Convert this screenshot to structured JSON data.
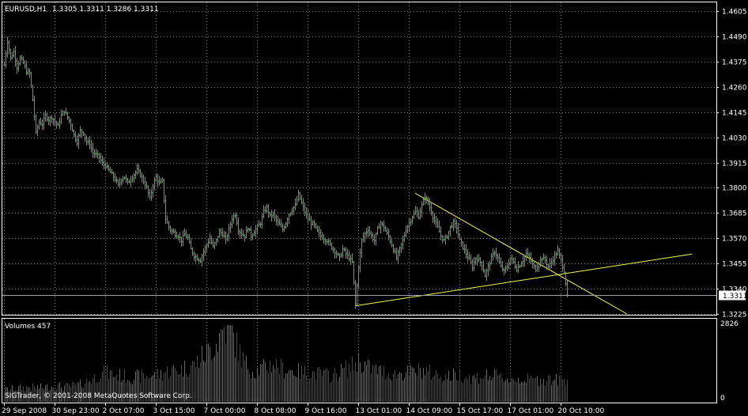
{
  "header": {
    "symbol": "EURUSD,H1",
    "ohlc": "1.3305 1.3311 1.3286 1.3311",
    "volume_title": "Volumes 457",
    "copyright": "SIGTrader, © 2001-2008 MetaQuotes Software Corp."
  },
  "colors": {
    "background": "#000000",
    "frame": "#ffffff",
    "grid": "#6d8fa3",
    "bar": "#2fbf2f",
    "volume_up": "#1f9f1f",
    "volume_down": "#b11c1c",
    "trendline": "#f5f54a",
    "price_line": "#9aa3ad",
    "current_price_box": "#ffffff"
  },
  "current_price": "1.3311",
  "chart_data": [
    {
      "type": "ohlc-bar",
      "title": "EURUSD,H1",
      "y_ticks": [
        1.4605,
        1.449,
        1.4375,
        1.426,
        1.4145,
        1.403,
        1.3915,
        1.38,
        1.3685,
        1.357,
        1.3455,
        1.334,
        1.3225
      ],
      "y_tick_labels": [
        "1.4605",
        "1.4490",
        "1.4375",
        "1.4260",
        "1.4145",
        "1.4030",
        "1.3915",
        "1.3800",
        "1.3685",
        "1.3570",
        "1.3455",
        "1.3340",
        "1.3225"
      ],
      "ylim": [
        1.3225,
        1.4605
      ],
      "x_tick_labels": [
        "29 Sep 2008",
        "30 Sep 23:00",
        "2 Oct 07:00",
        "3 Oct 15:00",
        "7 Oct 00:00",
        "8 Oct 08:00",
        "9 Oct 16:00",
        "13 Oct 01:00",
        "14 Oct 09:00",
        "15 Oct 17:00",
        "17 Oct 01:00",
        "20 Oct 10:00"
      ],
      "x_tick_index": [
        0,
        32,
        64,
        96,
        128,
        160,
        192,
        224,
        256,
        288,
        320,
        352
      ],
      "grid": true,
      "close_path": [
        [
          0,
          1.436
        ],
        [
          2,
          1.447
        ],
        [
          4,
          1.439
        ],
        [
          6,
          1.442
        ],
        [
          8,
          1.435
        ],
        [
          10,
          1.439
        ],
        [
          12,
          1.437
        ],
        [
          14,
          1.433
        ],
        [
          16,
          1.432
        ],
        [
          18,
          1.42
        ],
        [
          20,
          1.405
        ],
        [
          22,
          1.41
        ],
        [
          24,
          1.409
        ],
        [
          26,
          1.413
        ],
        [
          28,
          1.411
        ],
        [
          30,
          1.412
        ],
        [
          32,
          1.41
        ],
        [
          34,
          1.408
        ],
        [
          36,
          1.413
        ],
        [
          38,
          1.415
        ],
        [
          40,
          1.412
        ],
        [
          42,
          1.409
        ],
        [
          44,
          1.404
        ],
        [
          46,
          1.401
        ],
        [
          48,
          1.406
        ],
        [
          50,
          1.405
        ],
        [
          52,
          1.401
        ],
        [
          54,
          1.4
        ],
        [
          56,
          1.396
        ],
        [
          58,
          1.395
        ],
        [
          60,
          1.394
        ],
        [
          62,
          1.391
        ],
        [
          64,
          1.39
        ],
        [
          66,
          1.388
        ],
        [
          68,
          1.386
        ],
        [
          70,
          1.384
        ],
        [
          72,
          1.381
        ],
        [
          74,
          1.384
        ],
        [
          76,
          1.385
        ],
        [
          78,
          1.382
        ],
        [
          80,
          1.384
        ],
        [
          82,
          1.386
        ],
        [
          84,
          1.388
        ],
        [
          86,
          1.386
        ],
        [
          88,
          1.383
        ],
        [
          90,
          1.38
        ],
        [
          92,
          1.375
        ],
        [
          94,
          1.381
        ],
        [
          96,
          1.385
        ],
        [
          98,
          1.382
        ],
        [
          100,
          1.383
        ],
        [
          102,
          1.366
        ],
        [
          104,
          1.362
        ],
        [
          106,
          1.36
        ],
        [
          108,
          1.359
        ],
        [
          110,
          1.358
        ],
        [
          112,
          1.356
        ],
        [
          114,
          1.359
        ],
        [
          116,
          1.357
        ],
        [
          118,
          1.352
        ],
        [
          120,
          1.349
        ],
        [
          122,
          1.348
        ],
        [
          124,
          1.347
        ],
        [
          126,
          1.351
        ],
        [
          128,
          1.354
        ],
        [
          130,
          1.357
        ],
        [
          132,
          1.353
        ],
        [
          134,
          1.356
        ],
        [
          136,
          1.36
        ],
        [
          138,
          1.359
        ],
        [
          140,
          1.356
        ],
        [
          142,
          1.361
        ],
        [
          144,
          1.366
        ],
        [
          146,
          1.368
        ],
        [
          148,
          1.361
        ],
        [
          150,
          1.359
        ],
        [
          152,
          1.358
        ],
        [
          154,
          1.362
        ],
        [
          156,
          1.358
        ],
        [
          158,
          1.36
        ],
        [
          160,
          1.362
        ],
        [
          162,
          1.364
        ],
        [
          164,
          1.369
        ],
        [
          166,
          1.371
        ],
        [
          168,
          1.367
        ],
        [
          170,
          1.368
        ],
        [
          172,
          1.365
        ],
        [
          174,
          1.363
        ],
        [
          176,
          1.361
        ],
        [
          178,
          1.364
        ],
        [
          180,
          1.368
        ],
        [
          182,
          1.37
        ],
        [
          184,
          1.372
        ],
        [
          186,
          1.377
        ],
        [
          188,
          1.373
        ],
        [
          190,
          1.369
        ],
        [
          192,
          1.366
        ],
        [
          194,
          1.364
        ],
        [
          196,
          1.363
        ],
        [
          198,
          1.36
        ],
        [
          200,
          1.358
        ],
        [
          202,
          1.357
        ],
        [
          204,
          1.356
        ],
        [
          206,
          1.354
        ],
        [
          208,
          1.352
        ],
        [
          210,
          1.35
        ],
        [
          212,
          1.348
        ],
        [
          214,
          1.352
        ],
        [
          216,
          1.35
        ],
        [
          218,
          1.348
        ],
        [
          220,
          1.346
        ],
        [
          222,
          1.327
        ],
        [
          224,
          1.344
        ],
        [
          226,
          1.356
        ],
        [
          228,
          1.359
        ],
        [
          230,
          1.361
        ],
        [
          232,
          1.358
        ],
        [
          234,
          1.356
        ],
        [
          236,
          1.361
        ],
        [
          238,
          1.364
        ],
        [
          240,
          1.362
        ],
        [
          242,
          1.359
        ],
        [
          244,
          1.356
        ],
        [
          246,
          1.352
        ],
        [
          248,
          1.348
        ],
        [
          250,
          1.352
        ],
        [
          252,
          1.356
        ],
        [
          254,
          1.361
        ],
        [
          256,
          1.364
        ],
        [
          258,
          1.367
        ],
        [
          260,
          1.369
        ],
        [
          262,
          1.367
        ],
        [
          264,
          1.372
        ],
        [
          266,
          1.376
        ],
        [
          268,
          1.373
        ],
        [
          270,
          1.369
        ],
        [
          272,
          1.365
        ],
        [
          274,
          1.362
        ],
        [
          276,
          1.358
        ],
        [
          278,
          1.356
        ],
        [
          280,
          1.358
        ],
        [
          282,
          1.362
        ],
        [
          284,
          1.364
        ],
        [
          286,
          1.362
        ],
        [
          288,
          1.356
        ],
        [
          290,
          1.353
        ],
        [
          292,
          1.35
        ],
        [
          294,
          1.347
        ],
        [
          296,
          1.344
        ],
        [
          298,
          1.348
        ],
        [
          300,
          1.347
        ],
        [
          302,
          1.345
        ],
        [
          304,
          1.34
        ],
        [
          306,
          1.344
        ],
        [
          308,
          1.348
        ],
        [
          310,
          1.351
        ],
        [
          312,
          1.348
        ],
        [
          314,
          1.344
        ],
        [
          316,
          1.342
        ],
        [
          318,
          1.344
        ],
        [
          320,
          1.348
        ],
        [
          322,
          1.346
        ],
        [
          324,
          1.343
        ],
        [
          326,
          1.345
        ],
        [
          328,
          1.347
        ],
        [
          330,
          1.35
        ],
        [
          332,
          1.348
        ],
        [
          334,
          1.345
        ],
        [
          336,
          1.343
        ],
        [
          338,
          1.346
        ],
        [
          340,
          1.348
        ],
        [
          342,
          1.347
        ],
        [
          344,
          1.344
        ],
        [
          346,
          1.346
        ],
        [
          348,
          1.349
        ],
        [
          350,
          1.351
        ],
        [
          352,
          1.347
        ],
        [
          354,
          1.342
        ],
        [
          356,
          1.3311
        ]
      ],
      "trendlines": [
        {
          "from": [
            222,
            1.3262
          ],
          "to": [
            435,
            1.3498
          ]
        },
        {
          "from": [
            260,
            1.3775
          ],
          "to": [
            394,
            1.3225
          ]
        }
      ],
      "price_line": 1.3311
    },
    {
      "type": "bar",
      "title": "Volumes 457",
      "y_tick_labels": [
        "2826",
        "0"
      ],
      "ylim": [
        0,
        2826
      ],
      "volume_path": [
        [
          0,
          430
        ],
        [
          8,
          470
        ],
        [
          16,
          520
        ],
        [
          24,
          500
        ],
        [
          32,
          560
        ],
        [
          40,
          540
        ],
        [
          48,
          620
        ],
        [
          56,
          820
        ],
        [
          60,
          1000
        ],
        [
          64,
          1050
        ],
        [
          72,
          960
        ],
        [
          80,
          880
        ],
        [
          88,
          920
        ],
        [
          96,
          950
        ],
        [
          104,
          1120
        ],
        [
          112,
          1180
        ],
        [
          120,
          1350
        ],
        [
          126,
          1700
        ],
        [
          130,
          1900
        ],
        [
          134,
          2150
        ],
        [
          138,
          2650
        ],
        [
          141,
          2826
        ],
        [
          144,
          2500
        ],
        [
          148,
          1900
        ],
        [
          152,
          1400
        ],
        [
          158,
          1100
        ],
        [
          164,
          1220
        ],
        [
          170,
          1400
        ],
        [
          176,
          1200
        ],
        [
          184,
          1100
        ],
        [
          192,
          1050
        ],
        [
          200,
          1000
        ],
        [
          208,
          950
        ],
        [
          214,
          1150
        ],
        [
          220,
          1300
        ],
        [
          224,
          1500
        ],
        [
          230,
          1250
        ],
        [
          238,
          1100
        ],
        [
          246,
          1000
        ],
        [
          256,
          1050
        ],
        [
          264,
          1150
        ],
        [
          272,
          1000
        ],
        [
          280,
          900
        ],
        [
          288,
          1000
        ],
        [
          296,
          850
        ],
        [
          304,
          950
        ],
        [
          312,
          900
        ],
        [
          320,
          800
        ],
        [
          328,
          820
        ],
        [
          336,
          780
        ],
        [
          344,
          830
        ],
        [
          352,
          760
        ],
        [
          356,
          860
        ]
      ]
    }
  ]
}
